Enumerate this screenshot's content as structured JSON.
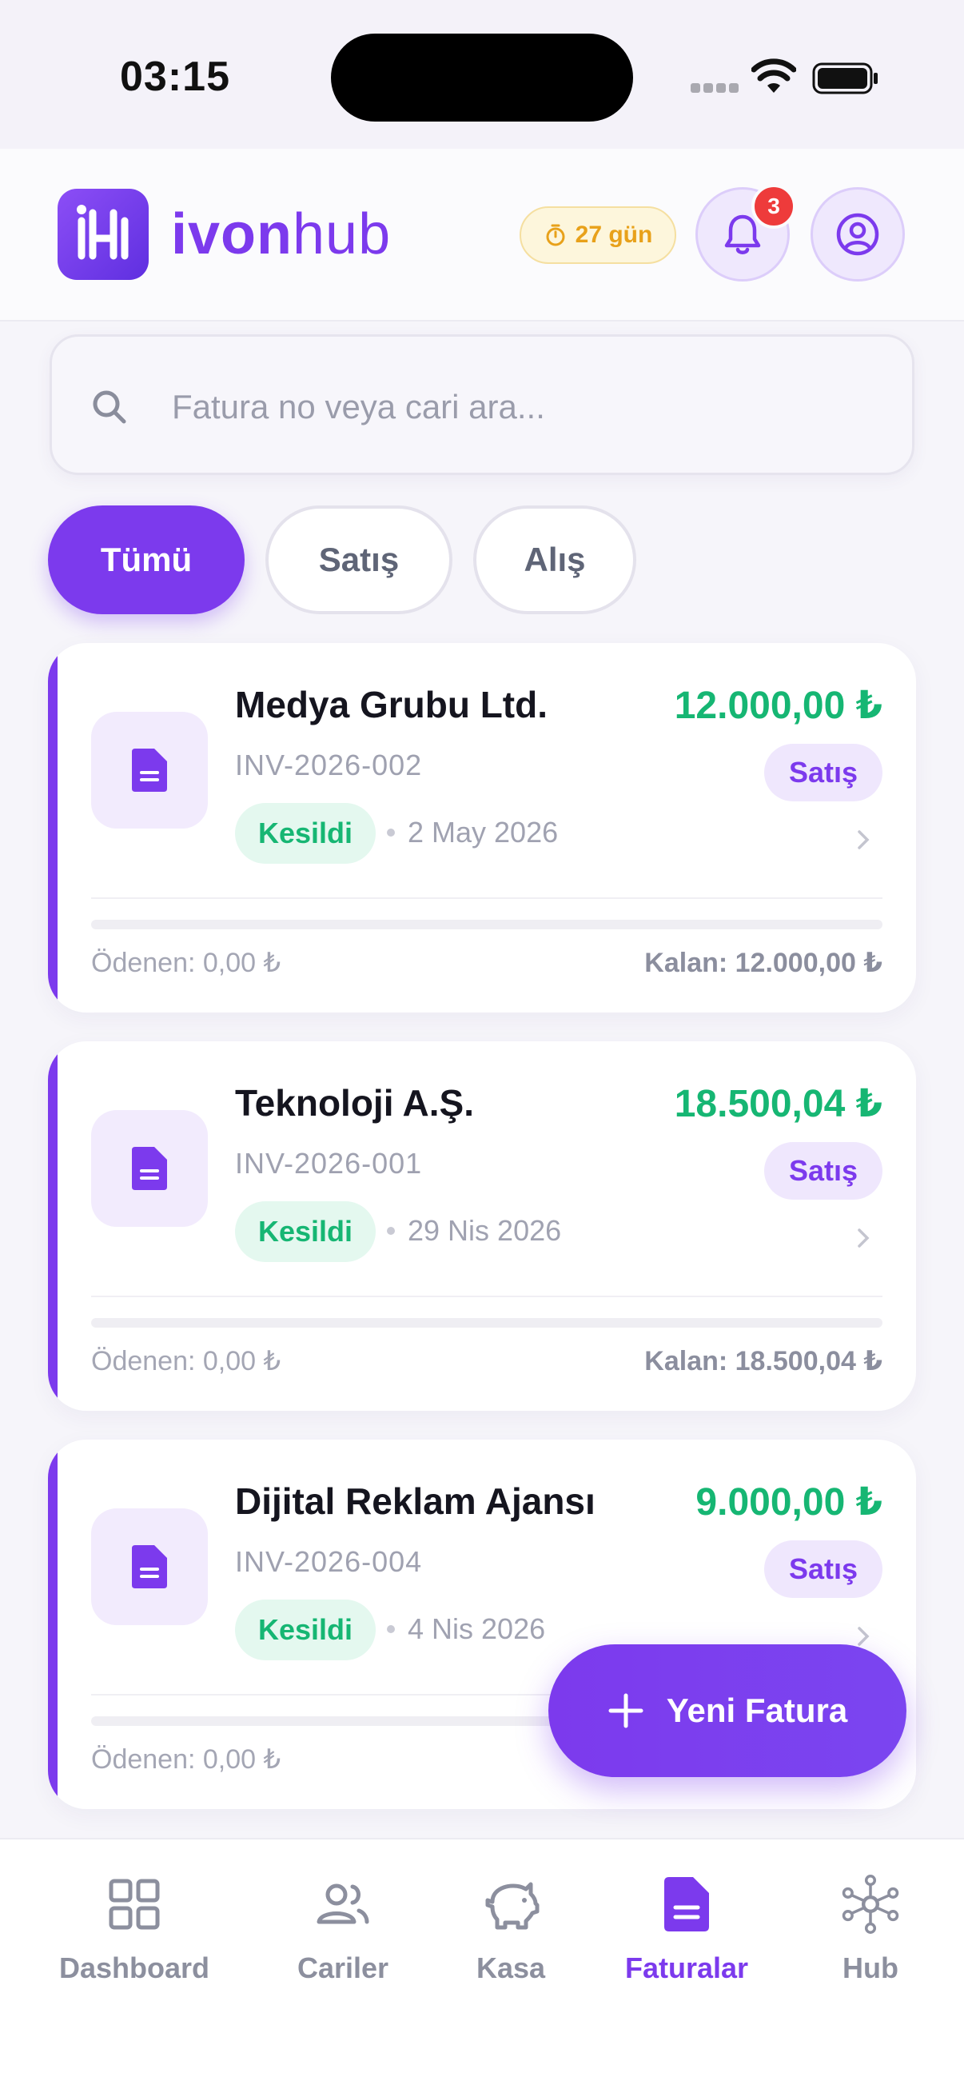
{
  "status_bar": {
    "time": "03:15"
  },
  "header": {
    "logo_bold": "ivon",
    "logo_light": "hub",
    "trial_label": "27 gün",
    "notification_count": "3"
  },
  "search": {
    "placeholder": "Fatura no veya cari ara..."
  },
  "filters": [
    "Tümü",
    "Satış",
    "Alış"
  ],
  "invoices": [
    {
      "name": "Medya Grubu Ltd.",
      "number": "INV-2026-002",
      "amount": "12.000,00 ₺",
      "type": "Satış",
      "status": "Kesildi",
      "date": "2 May 2026",
      "paid": "Ödenen: 0,00 ₺",
      "remaining": "Kalan: 12.000,00 ₺",
      "paid_fraction": 0
    },
    {
      "name": "Teknoloji A.Ş.",
      "number": "INV-2026-001",
      "amount": "18.500,04 ₺",
      "type": "Satış",
      "status": "Kesildi",
      "date": "29 Nis 2026",
      "paid": "Ödenen: 0,00 ₺",
      "remaining": "Kalan: 18.500,04 ₺",
      "paid_fraction": 0
    },
    {
      "name": "Dijital Reklam Ajansı",
      "number": "INV-2026-004",
      "amount": "9.000,00 ₺",
      "type": "Satış",
      "status": "Kesildi",
      "date": "4 Nis 2026",
      "paid": "Ödenen: 0,00 ₺",
      "remaining": "",
      "paid_fraction": 0
    }
  ],
  "fab": {
    "label": "Yeni Fatura",
    "icon": "plus-icon"
  },
  "nav": [
    {
      "label": "Dashboard",
      "icon": "grid-icon",
      "active": false
    },
    {
      "label": "Cariler",
      "icon": "users-icon",
      "active": false
    },
    {
      "label": "Kasa",
      "icon": "piggy-bank-icon",
      "active": false
    },
    {
      "label": "Faturalar",
      "icon": "document-icon",
      "active": true
    },
    {
      "label": "Hub",
      "icon": "network-icon",
      "active": false
    }
  ],
  "colors": {
    "accent": "#7c3aed",
    "amount_green": "#16b673",
    "badge_red": "#ee3b3b",
    "trial_amber": "#e8a11a"
  }
}
